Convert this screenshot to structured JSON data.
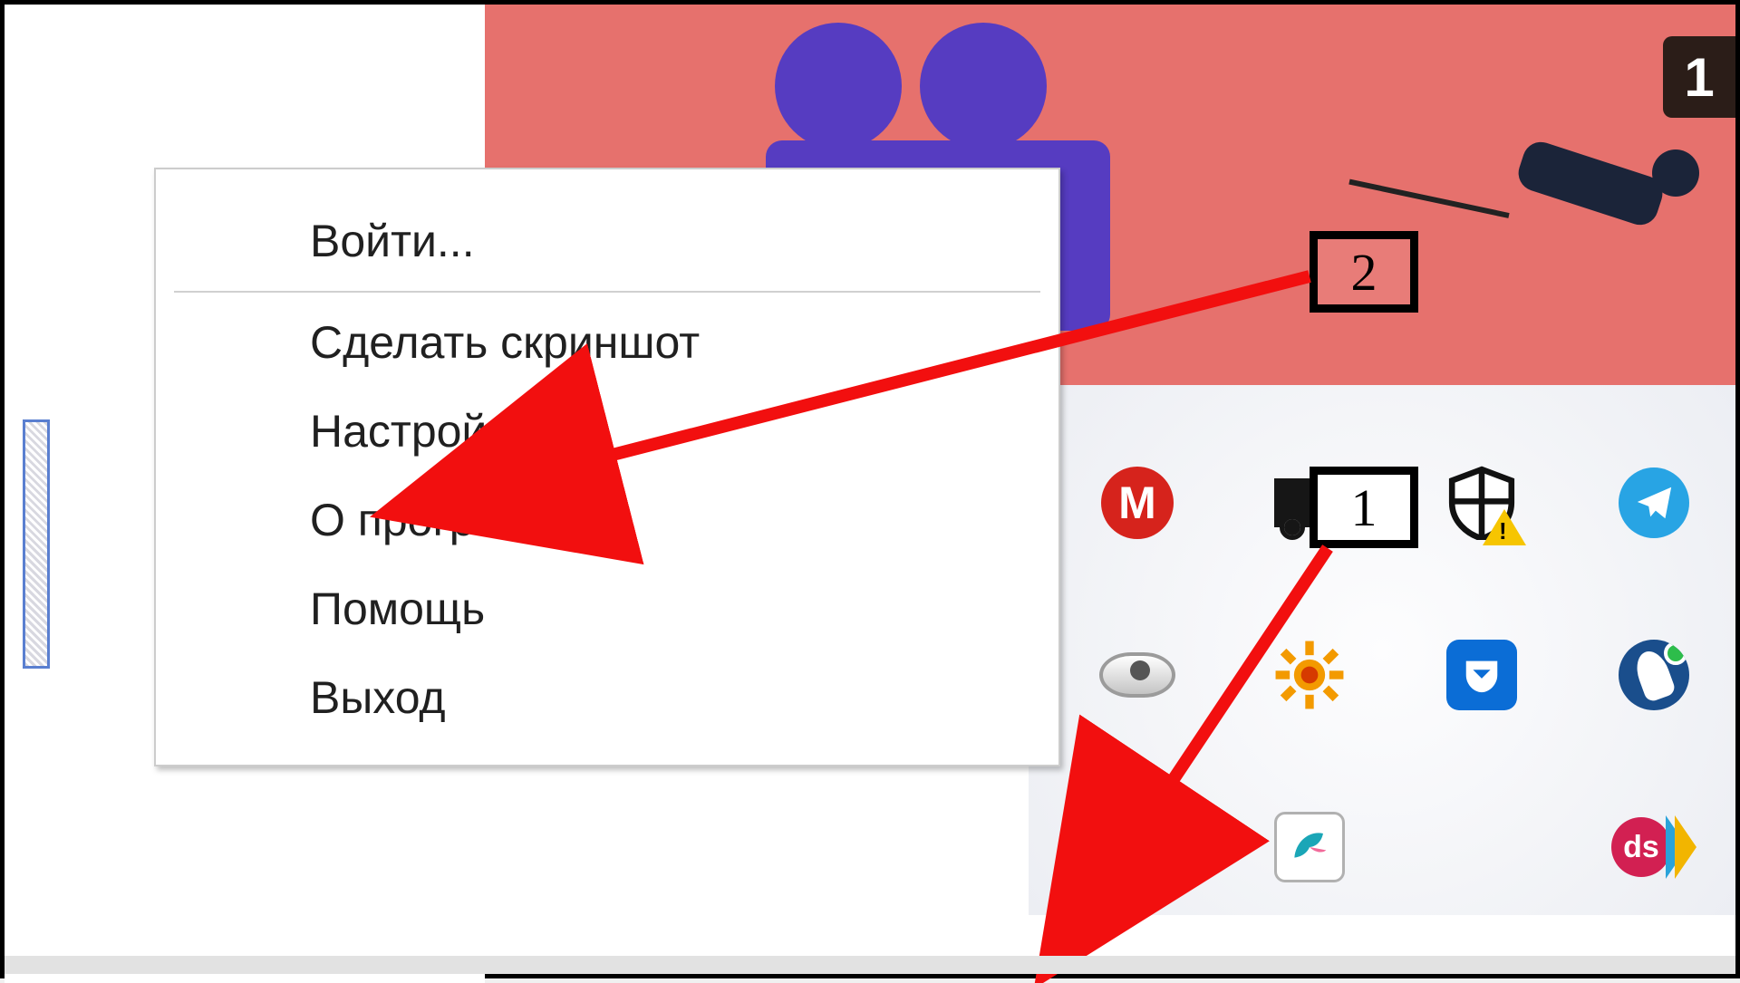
{
  "context_menu": {
    "login": "Войти...",
    "screenshot": "Сделать скриншот",
    "settings": "Настройки...",
    "about": "О программе...",
    "help": "Помощь",
    "exit": "Выход"
  },
  "callouts": {
    "one": "1",
    "two": "2"
  },
  "badge": "1",
  "tray_icons": {
    "mega": "M",
    "ds": "ds"
  },
  "colors": {
    "coral": "#e6716d",
    "arrow": "#f20f0f",
    "menu_text": "#202020"
  }
}
